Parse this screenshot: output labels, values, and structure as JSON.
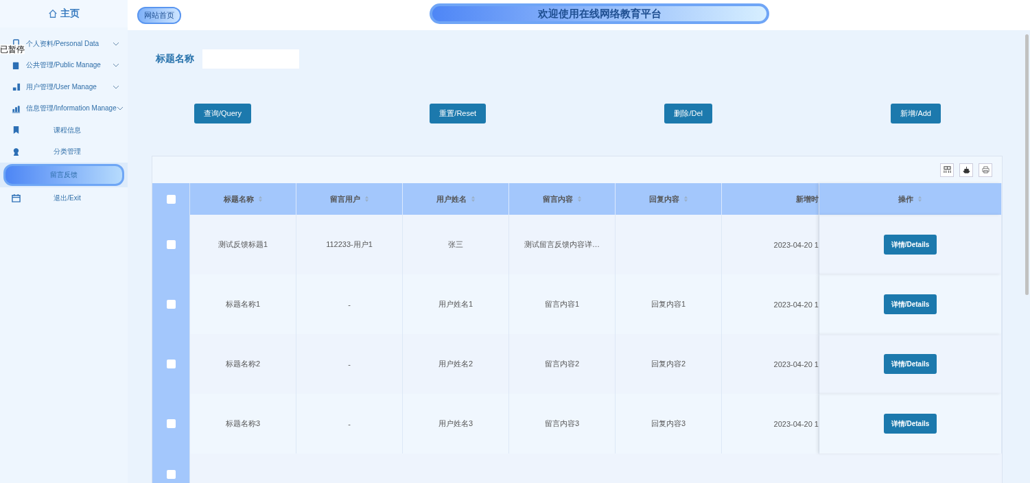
{
  "sidebar": {
    "home": "主页",
    "items": [
      {
        "label": "个人资料/Personal Data",
        "kind": "group",
        "selected": false
      },
      {
        "label": "公共管理/Public Manage",
        "kind": "group",
        "selected": false
      },
      {
        "label": "用户管理/User Manage",
        "kind": "group",
        "selected": false
      },
      {
        "label": "信息管理/Information Manage",
        "kind": "group",
        "selected": false
      },
      {
        "label": "课程信息",
        "kind": "link",
        "selected": false
      },
      {
        "label": "分类管理",
        "kind": "link",
        "selected": false
      },
      {
        "label": "留言反馈",
        "kind": "link",
        "selected": true
      },
      {
        "label": "退出/Exit",
        "kind": "link",
        "selected": false
      }
    ]
  },
  "overlay_status": "已暂停",
  "header": {
    "home_link": "网站首页",
    "title": "欢迎使用在线网络教育平台"
  },
  "search": {
    "label": "标题名称"
  },
  "buttons": [
    "查询/Query",
    "重置/Reset",
    "删除/Del",
    "新增/Add"
  ],
  "table": {
    "select_all": false,
    "columns": [
      "标题名称",
      "留言用户",
      "用户姓名",
      "留言内容",
      "回复内容",
      "新增时",
      "操作"
    ],
    "rows": [
      {
        "selected": false,
        "cells": [
          "测试反馈标题1",
          "112233-用户1",
          "张三",
          "测试留言反馈内容详…",
          "",
          "2023-04-20 1"
        ],
        "action": "详情/Details"
      },
      {
        "selected": false,
        "cells": [
          "标题名称1",
          "-",
          "用户姓名1",
          "留言内容1",
          "回复内容1",
          "2023-04-20 1"
        ],
        "action": "详情/Details"
      },
      {
        "selected": false,
        "cells": [
          "标题名称2",
          "-",
          "用户姓名2",
          "留言内容2",
          "回复内容2",
          "2023-04-20 1"
        ],
        "action": "详情/Details"
      },
      {
        "selected": false,
        "cells": [
          "标题名称3",
          "-",
          "用户姓名3",
          "留言内容3",
          "回复内容3",
          "2023-04-20 1"
        ],
        "action": "详情/Details"
      }
    ],
    "cut_row": {
      "selected": false
    }
  }
}
